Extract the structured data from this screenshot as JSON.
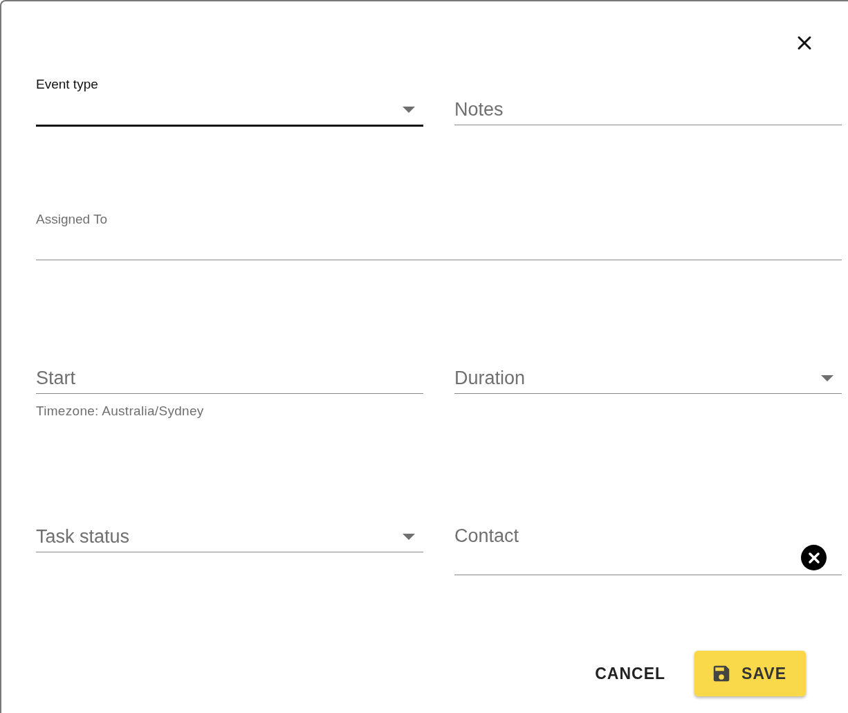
{
  "rows": [
    {
      "fields": [
        {
          "kind": "select",
          "label": "Event type",
          "floated": true,
          "focused": true
        },
        {
          "kind": "text",
          "label": "Notes",
          "floated": false,
          "focused": false
        }
      ]
    },
    {
      "fields": [
        {
          "kind": "text",
          "label": "Assigned To",
          "floated": true,
          "focused": false
        }
      ]
    },
    {
      "fields": [
        {
          "kind": "text",
          "label": "Start",
          "floated": false,
          "focused": false,
          "helper": "Timezone: Australia/Sydney"
        },
        {
          "kind": "select",
          "label": "Duration",
          "floated": false,
          "focused": false
        }
      ]
    },
    {
      "fields": [
        {
          "kind": "select",
          "label": "Task status",
          "floated": false,
          "focused": false
        },
        {
          "kind": "clearable",
          "label": "Contact",
          "floated": false,
          "focused": false
        }
      ]
    }
  ],
  "actions": [
    {
      "kind": "text",
      "label": "CANCEL"
    },
    {
      "kind": "primary",
      "label": "SAVE"
    }
  ]
}
